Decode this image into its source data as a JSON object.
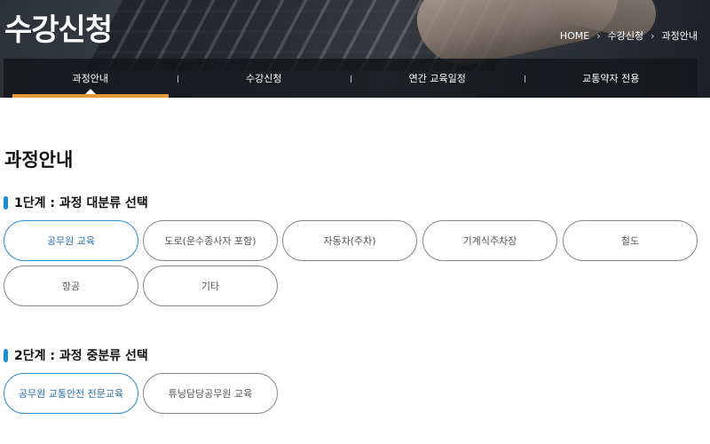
{
  "header": {
    "title": "수강신청",
    "breadcrumb": [
      "HOME",
      "수강신청",
      "과정안내"
    ]
  },
  "tabs": [
    {
      "label": "과정안내",
      "active": true
    },
    {
      "label": "수강신청",
      "active": false
    },
    {
      "label": "연간 교육일정",
      "active": false
    },
    {
      "label": "교통약자 전용",
      "active": false
    }
  ],
  "main": {
    "page_title": "과정안내",
    "step1": {
      "heading": "1단계 : 과정 대분류 선택",
      "options": [
        "공무원 교육",
        "도로(운수종사자 포함)",
        "자동차(주차)",
        "기계식주차장",
        "철도",
        "항공",
        "기타"
      ],
      "selected": "공무원 교육"
    },
    "step2": {
      "heading": "2단계 : 과정 중분류 선택",
      "options": [
        "공무원 교통안전 전문교육",
        "튜닝담당공무원 교육"
      ],
      "selected": "공무원 교통안전 전문교육"
    }
  },
  "colors": {
    "accent_blue": "#1a8ed4",
    "tab_active_underline": "#e39a3b",
    "selected_border": "#2f8fd0"
  }
}
